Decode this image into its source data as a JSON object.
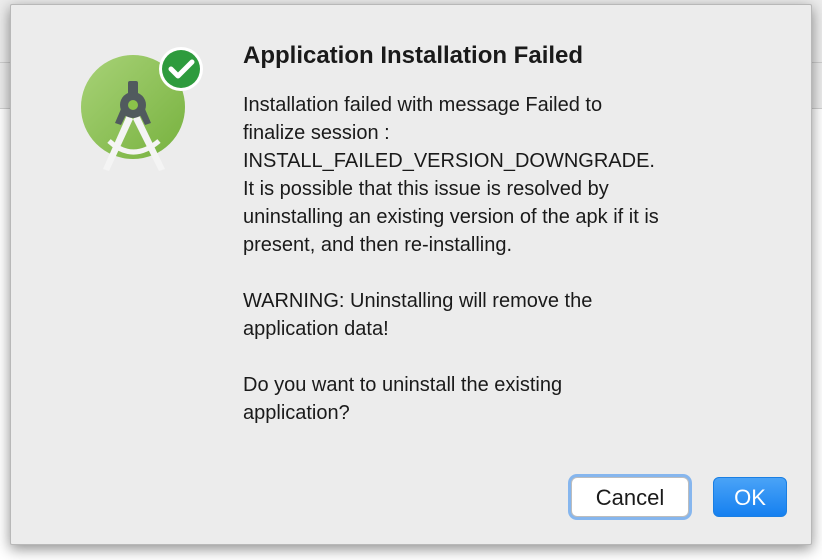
{
  "dialog": {
    "title": "Application Installation Failed",
    "paragraphs": [
      {
        "lines": [
          "Installation failed with message Failed to",
          "finalize session :",
          "INSTALL_FAILED_VERSION_DOWNGRADE.",
          "It is possible that this issue is resolved by",
          "uninstalling an existing version of the apk if it is",
          "present, and then re-installing."
        ]
      },
      {
        "lines": [
          "WARNING: Uninstalling will remove the",
          "application data!"
        ]
      },
      {
        "lines": [
          "Do you want to uninstall the existing",
          "application?"
        ]
      }
    ],
    "buttons": {
      "cancel_label": "Cancel",
      "ok_label": "OK"
    },
    "icon": "android-studio-icon",
    "badge_icon": "checkmark-badge-icon"
  },
  "background": {
    "help_glyph": "?"
  },
  "colors": {
    "dialog_bg": "#ececec",
    "ok_button": "#1b8af5",
    "focus_ring": "#86b6ee",
    "icon_green": "#8bc34a",
    "badge_green": "#2e9b3d"
  }
}
